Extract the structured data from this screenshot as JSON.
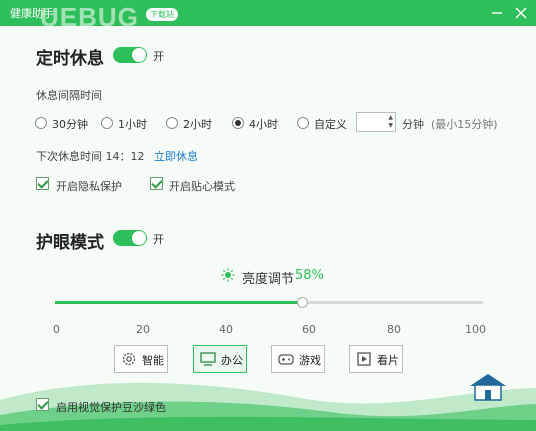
{
  "window": {
    "title": "健康助手",
    "watermark": "UEBUG",
    "watermark_badge": "下载站",
    "minimize_icon": "minimize-icon",
    "close_icon": "close-icon"
  },
  "rest_timer": {
    "title": "定时休息",
    "toggle_on": true,
    "toggle_label": "开",
    "interval_label": "休息间隔时间",
    "options": [
      {
        "label": "30分钟",
        "checked": false
      },
      {
        "label": "1小时",
        "checked": false
      },
      {
        "label": "2小时",
        "checked": false
      },
      {
        "label": "4小时",
        "checked": true
      },
      {
        "label": "自定义",
        "checked": false
      }
    ],
    "custom_value": "",
    "custom_unit": "分钟",
    "custom_hint": "(最小15分钟)",
    "next_rest_label": "下次休息时间 14：12",
    "rest_now_link": "立即休息",
    "privacy_label": "开启隐私保护",
    "privacy_checked": true,
    "caring_label": "开启贴心模式",
    "caring_checked": true
  },
  "eye_care": {
    "title": "护眼模式",
    "toggle_on": true,
    "toggle_label": "开",
    "brightness_label": "亮度调节",
    "brightness_value": "58%",
    "brightness_fraction": 0.58,
    "slider_ticks": [
      "0",
      "20",
      "40",
      "60",
      "80",
      "100"
    ],
    "modes": [
      {
        "label": "智能",
        "icon": "gear-icon",
        "active": false
      },
      {
        "label": "办公",
        "icon": "monitor-icon",
        "active": true
      },
      {
        "label": "游戏",
        "icon": "gamepad-icon",
        "active": false
      },
      {
        "label": "看片",
        "icon": "film-icon",
        "active": false
      }
    ]
  },
  "footer": {
    "green_bg_label": "启用视觉保护豆沙绿色",
    "green_bg_checked": true
  },
  "colors": {
    "accent": "#2fbf5a",
    "link": "#1a7fd6",
    "background": "#f5fbf6"
  }
}
